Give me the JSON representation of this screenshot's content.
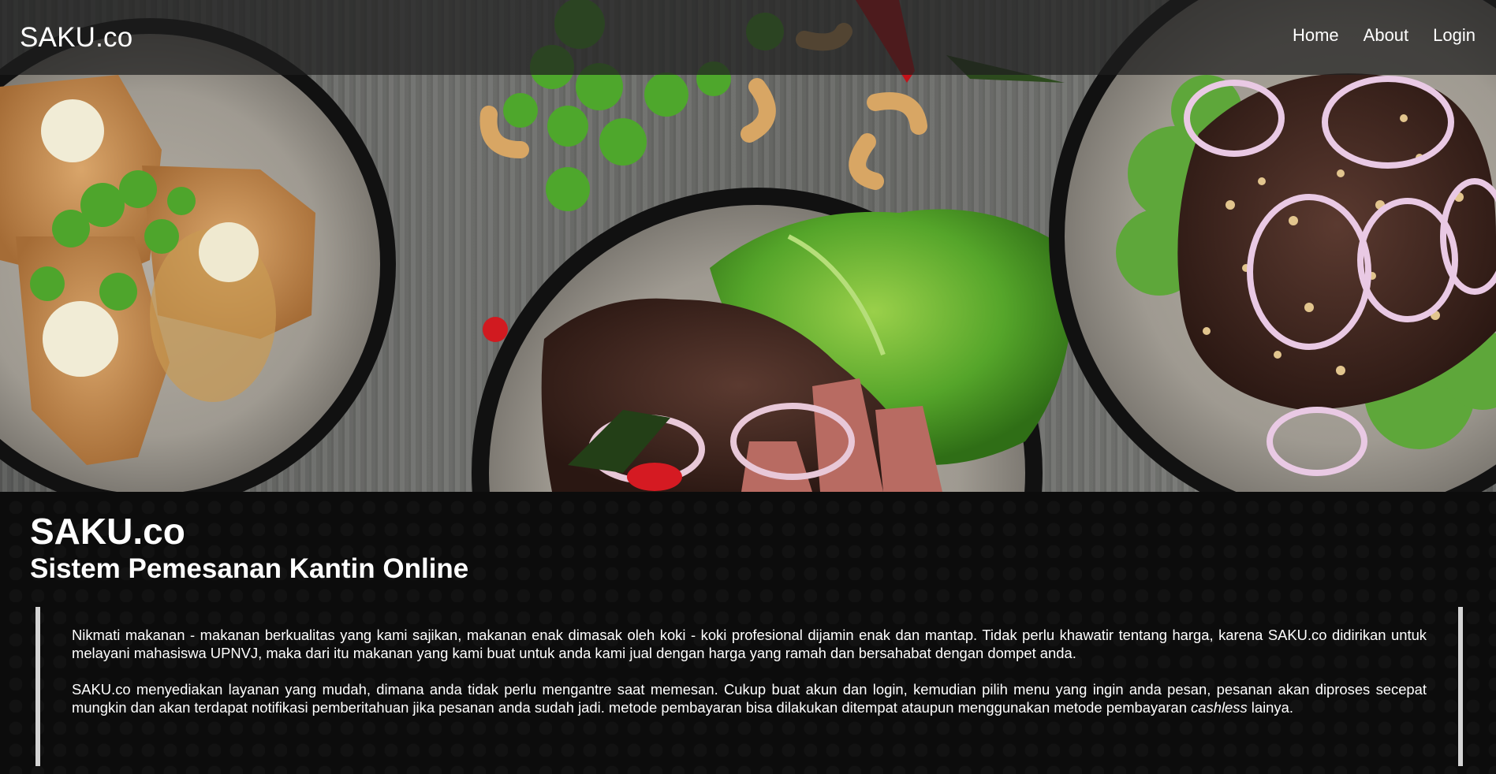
{
  "navbar": {
    "brand": "SAKU.co",
    "links": [
      "Home",
      "About",
      "Login"
    ]
  },
  "hero": {
    "image": "food-plates-banner"
  },
  "main": {
    "title": "SAKU.co",
    "subtitle": "Sistem Pemesanan Kantin Online",
    "paragraph1": "Nikmati makanan - makanan berkualitas yang kami sajikan, makanan enak dimasak oleh koki - koki profesional dijamin enak dan mantap. Tidak perlu khawatir tentang harga, karena SAKU.co didirikan untuk melayani mahasiswa UPNVJ, maka dari itu makanan yang kami buat untuk anda kami jual dengan harga yang ramah dan bersahabat dengan dompet anda.",
    "paragraph2_before": "SAKU.co menyediakan layanan yang mudah, dimana anda tidak perlu mengantre saat memesan. Cukup buat akun dan login, kemudian pilih menu yang ingin anda pesan, pesanan akan diproses secepat mungkin dan akan terdapat notifikasi pemberitahuan jika pesanan anda sudah jadi. metode pembayaran bisa dilakukan ditempat ataupun menggunakan metode pembayaran ",
    "paragraph2_emphasis": "cashless",
    "paragraph2_after": " lainya."
  },
  "colors": {
    "navbar_bg": "#1e1e1e",
    "content_bg": "#0c0c0c",
    "quote_border": "#d4d4d4",
    "text": "#ffffff"
  }
}
